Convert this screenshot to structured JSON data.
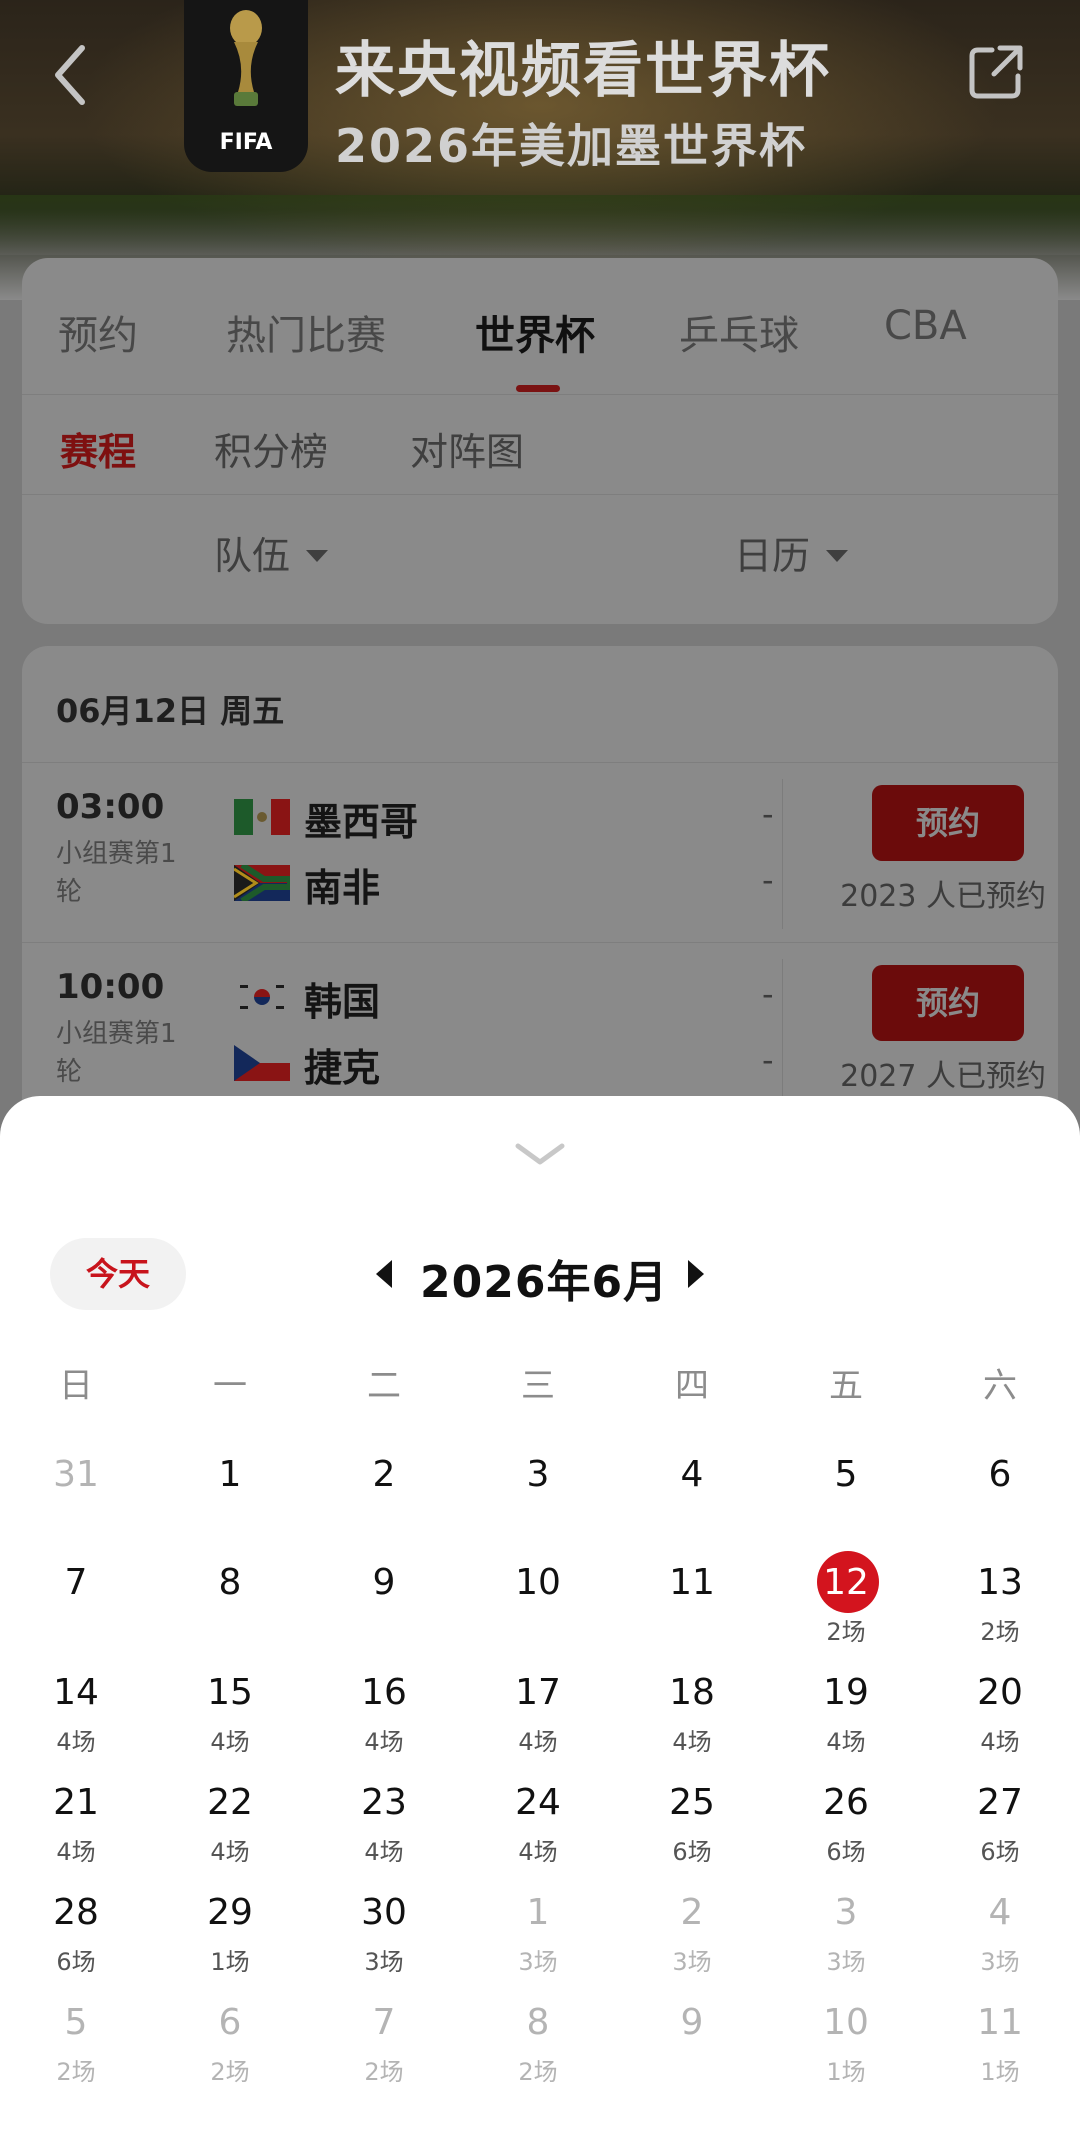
{
  "header": {
    "title": "来央视频看世界杯",
    "subtitle": "2026年美加墨世界杯",
    "logo_text": "FIFA"
  },
  "tabs": [
    {
      "label": "预约",
      "active": false
    },
    {
      "label": "热门比赛",
      "active": false
    },
    {
      "label": "世界杯",
      "active": true
    },
    {
      "label": "乒乓球",
      "active": false
    },
    {
      "label": "CBA",
      "active": false
    }
  ],
  "subtabs": [
    {
      "label": "赛程",
      "active": true
    },
    {
      "label": "积分榜",
      "active": false
    },
    {
      "label": "对阵图",
      "active": false
    }
  ],
  "filters": {
    "team": "队伍",
    "calendar": "日历"
  },
  "schedule": {
    "date": "06月12日 周五",
    "matches": [
      {
        "time": "03:00",
        "stage": "小组赛第1轮",
        "home": {
          "name": "墨西哥",
          "flag": "mexico-flag",
          "score": "-"
        },
        "away": {
          "name": "南非",
          "flag": "south-africa-flag",
          "score": "-"
        },
        "button": "预约",
        "booked": "2023 人已预约"
      },
      {
        "time": "10:00",
        "stage": "小组赛第1轮",
        "home": {
          "name": "韩国",
          "flag": "south-korea-flag",
          "score": "-"
        },
        "away": {
          "name": "捷克",
          "flag": "czech-flag",
          "score": "-"
        },
        "button": "预约",
        "booked": "2027 人已预约"
      }
    ]
  },
  "calendar": {
    "today_button": "今天",
    "month_title": "2026年6月",
    "weekdays": [
      "日",
      "一",
      "二",
      "三",
      "四",
      "五",
      "六"
    ],
    "selected_day": "12",
    "accent_color": "#d3141e",
    "days": [
      {
        "d": "31",
        "c": "",
        "dim": true
      },
      {
        "d": "1",
        "c": "",
        "dim": false
      },
      {
        "d": "2",
        "c": "",
        "dim": false
      },
      {
        "d": "3",
        "c": "",
        "dim": false
      },
      {
        "d": "4",
        "c": "",
        "dim": false
      },
      {
        "d": "5",
        "c": "",
        "dim": false
      },
      {
        "d": "6",
        "c": "",
        "dim": false
      },
      {
        "d": "7",
        "c": "",
        "dim": false
      },
      {
        "d": "8",
        "c": "",
        "dim": false
      },
      {
        "d": "9",
        "c": "",
        "dim": false
      },
      {
        "d": "10",
        "c": "",
        "dim": false
      },
      {
        "d": "11",
        "c": "",
        "dim": false
      },
      {
        "d": "12",
        "c": "2场",
        "dim": false,
        "selected": true
      },
      {
        "d": "13",
        "c": "2场",
        "dim": false
      },
      {
        "d": "14",
        "c": "4场",
        "dim": false
      },
      {
        "d": "15",
        "c": "4场",
        "dim": false
      },
      {
        "d": "16",
        "c": "4场",
        "dim": false
      },
      {
        "d": "17",
        "c": "4场",
        "dim": false
      },
      {
        "d": "18",
        "c": "4场",
        "dim": false
      },
      {
        "d": "19",
        "c": "4场",
        "dim": false
      },
      {
        "d": "20",
        "c": "4场",
        "dim": false
      },
      {
        "d": "21",
        "c": "4场",
        "dim": false
      },
      {
        "d": "22",
        "c": "4场",
        "dim": false
      },
      {
        "d": "23",
        "c": "4场",
        "dim": false
      },
      {
        "d": "24",
        "c": "4场",
        "dim": false
      },
      {
        "d": "25",
        "c": "6场",
        "dim": false
      },
      {
        "d": "26",
        "c": "6场",
        "dim": false
      },
      {
        "d": "27",
        "c": "6场",
        "dim": false
      },
      {
        "d": "28",
        "c": "6场",
        "dim": false
      },
      {
        "d": "29",
        "c": "1场",
        "dim": false
      },
      {
        "d": "30",
        "c": "3场",
        "dim": false
      },
      {
        "d": "1",
        "c": "3场",
        "dim": true
      },
      {
        "d": "2",
        "c": "3场",
        "dim": true
      },
      {
        "d": "3",
        "c": "3场",
        "dim": true
      },
      {
        "d": "4",
        "c": "3场",
        "dim": true
      },
      {
        "d": "5",
        "c": "2场",
        "dim": true
      },
      {
        "d": "6",
        "c": "2场",
        "dim": true
      },
      {
        "d": "7",
        "c": "2场",
        "dim": true
      },
      {
        "d": "8",
        "c": "2场",
        "dim": true
      },
      {
        "d": "9",
        "c": "",
        "dim": true
      },
      {
        "d": "10",
        "c": "1场",
        "dim": true
      },
      {
        "d": "11",
        "c": "1场",
        "dim": true
      }
    ]
  }
}
